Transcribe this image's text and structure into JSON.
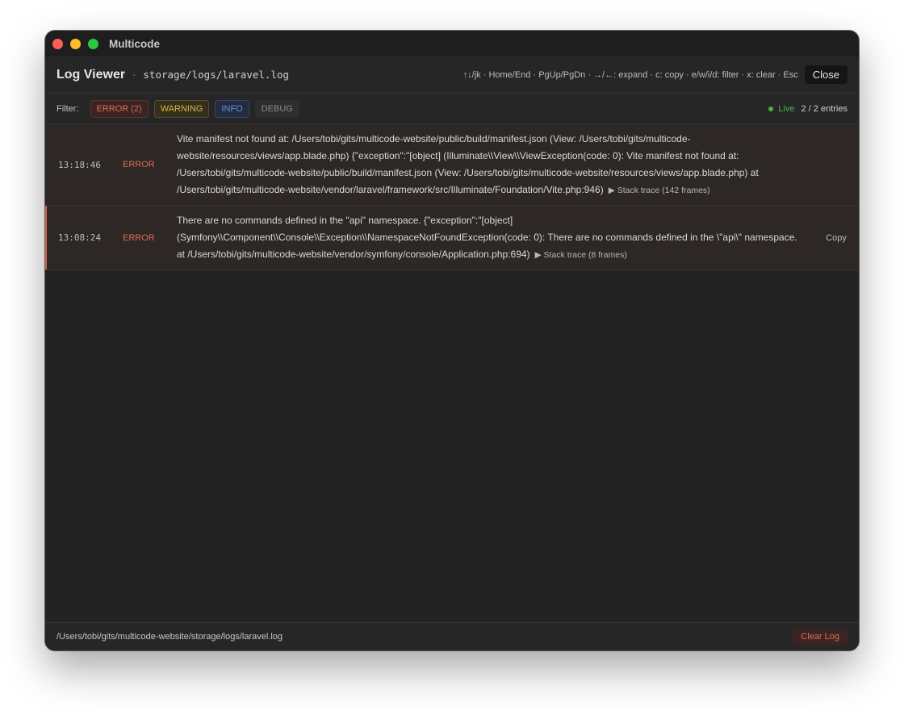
{
  "window": {
    "title": "Multicode",
    "traffic_lights": {
      "close": "#fe5f57",
      "minimize": "#febc2e",
      "maximize": "#28c840"
    }
  },
  "header": {
    "title": "Log Viewer",
    "separator": "·",
    "log_path": "storage/logs/laravel.log",
    "shortcuts": "↑↓/jk · Home/End · PgUp/PgDn · →/←: expand · c: copy · e/w/i/d: filter · x: clear · Esc",
    "close_label": "Close"
  },
  "filters": {
    "label": "Filter:",
    "error_label": "ERROR",
    "error_count": "(2)",
    "warning_label": "WARNING",
    "info_label": "INFO",
    "debug_label": "DEBUG",
    "live_label": "Live",
    "entries_label": "2 / 2 entries"
  },
  "entries": [
    {
      "time": "13:18:46",
      "level": "ERROR",
      "message": "Vite manifest not found at: /Users/tobi/gits/multicode-website/public/build/manifest.json (View: /Users/tobi/gits/multicode-website/resources/views/app.blade.php) {\"exception\":\"[object] (Illuminate\\\\View\\\\ViewException(code: 0): Vite manifest not found at: /Users/tobi/gits/multicode-website/public/build/manifest.json (View: /Users/tobi/gits/multicode-website/resources/views/app.blade.php) at /Users/tobi/gits/multicode-website/vendor/laravel/framework/src/Illuminate/Foundation/Vite.php:946)",
      "stack_trace": "▶ Stack trace (142 frames)"
    },
    {
      "time": "13:08:24",
      "level": "ERROR",
      "message": "There are no commands defined in the \"api\" namespace. {\"exception\":\"[object] (Symfony\\\\Component\\\\Console\\\\Exception\\\\NamespaceNotFoundException(code: 0): There are no commands defined in the \\\"api\\\" namespace. at /Users/tobi/gits/multicode-website/vendor/symfony/console/Application.php:694)",
      "stack_trace": "▶ Stack trace (8 frames)",
      "action": "Copy"
    }
  ],
  "footer": {
    "path": "/Users/tobi/gits/multicode-website/storage/logs/laravel.log",
    "clear_label": "Clear Log"
  }
}
